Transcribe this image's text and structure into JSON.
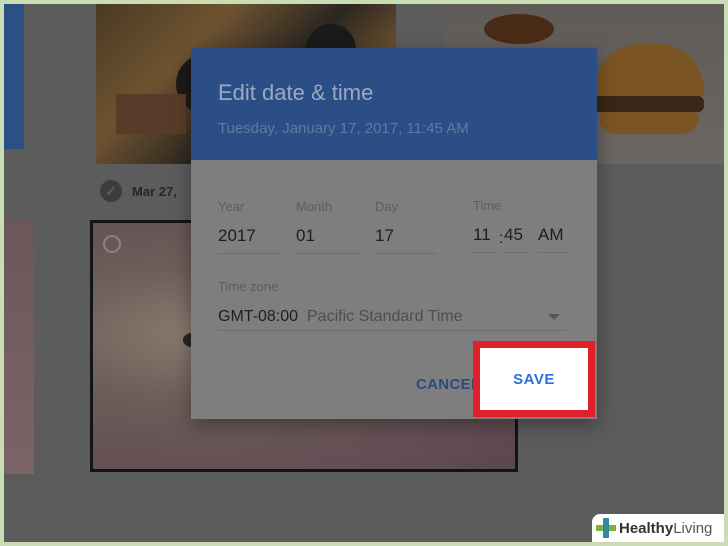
{
  "background": {
    "date_label": "Mar 27,"
  },
  "dialog": {
    "title": "Edit date & time",
    "subtitle": "Tuesday, January 17, 2017, 11:45 AM",
    "fields": {
      "year": {
        "label": "Year",
        "value": "2017"
      },
      "month": {
        "label": "Month",
        "value": "01"
      },
      "day": {
        "label": "Day",
        "value": "17"
      },
      "time": {
        "label": "Time",
        "hour": "11",
        "separator": ":",
        "minute": "45",
        "ampm": "AM"
      }
    },
    "timezone": {
      "label": "Time zone",
      "offset": "GMT-08:00",
      "name": "Pacific Standard Time"
    },
    "cancel_label": "CANCEL",
    "save_label": "SAVE"
  },
  "watermark": {
    "part1": "Healthy",
    "part2": "Living"
  },
  "colors": {
    "header_blue": "#2a4e85",
    "highlight_red": "#e0202a",
    "save_text_blue": "#2f6fd6"
  }
}
